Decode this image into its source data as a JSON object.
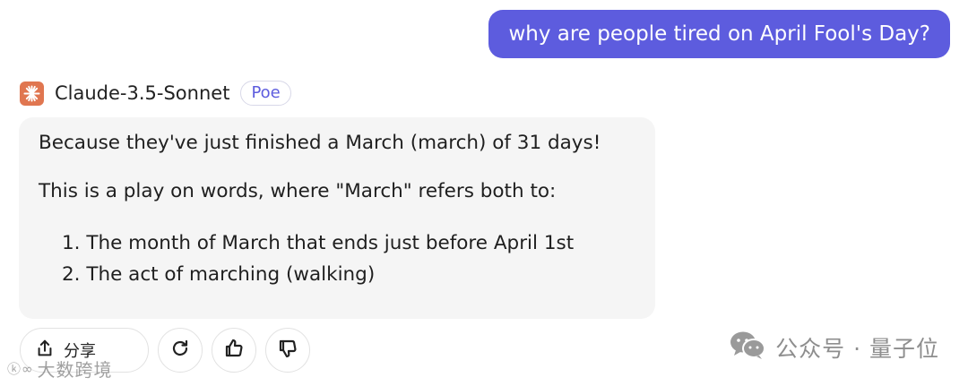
{
  "user_message": "why are people tired on April Fool's Day?",
  "bot": {
    "avatar_icon": "claude-starburst-icon",
    "name": "Claude-3.5-Sonnet",
    "badge": "Poe"
  },
  "response": {
    "line1": "Because they've just finished a March (march) of 31 days!",
    "line2": "This is a play on words, where \"March\" refers both to:",
    "list": [
      "1. The month of March that ends just before April 1st",
      "2. The act of marching (walking)"
    ]
  },
  "actions": {
    "share_label": "分享",
    "share_icon": "share-upload-icon",
    "regenerate_icon": "refresh-icon",
    "like_icon": "thumbs-up-icon",
    "dislike_icon": "thumbs-down-icon"
  },
  "watermarks": {
    "left": "大数跨境",
    "right": "公众号 · 量子位"
  },
  "colors": {
    "user_bubble": "#5d5cde",
    "avatar": "#e07650",
    "bot_bubble": "#f5f5f5"
  }
}
